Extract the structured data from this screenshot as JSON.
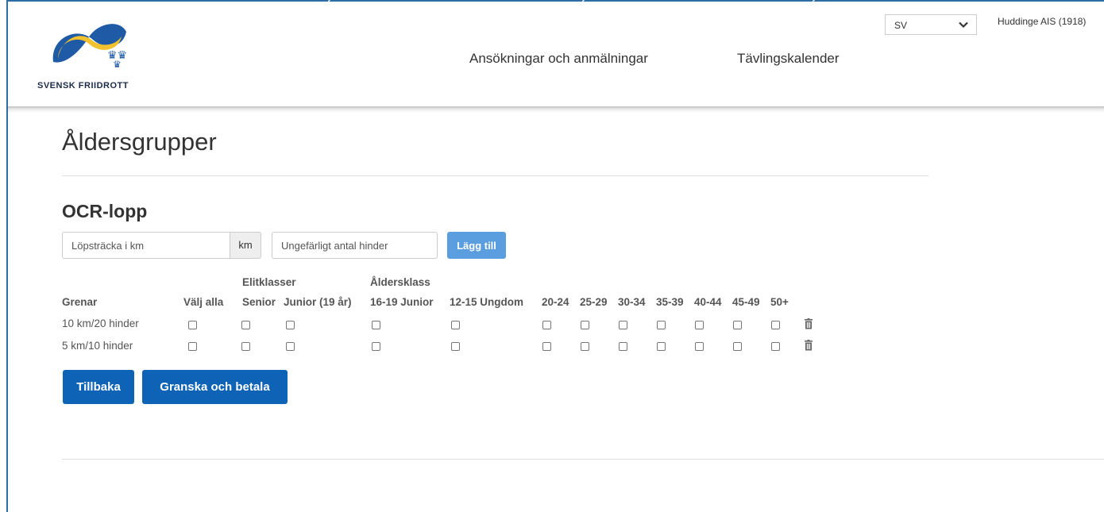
{
  "brand": {
    "logo_text": "SVENSK FRIIDROTT"
  },
  "nav": {
    "items": [
      "Ansökningar och anmälningar",
      "Tävlingskalender"
    ]
  },
  "language": {
    "selected": "SV"
  },
  "user": {
    "club": "Huddinge AIS (1918)"
  },
  "page": {
    "title": "Åldersgrupper"
  },
  "section": {
    "title": "OCR-lopp"
  },
  "form": {
    "distance_placeholder": "Löpsträcka i km",
    "unit": "km",
    "obstacles_placeholder": "Ungefärligt antal hinder",
    "add_button": "Lägg till"
  },
  "table": {
    "group_headers": {
      "elite": "Elitklasser",
      "age": "Åldersklass"
    },
    "columns": {
      "event": "Grenar",
      "select_all": "Välj alla",
      "senior": "Senior",
      "junior": "Junior (19 år)",
      "u19": "16-19 Junior",
      "u15": "12-15 Ungdom",
      "a20": "20-24",
      "a25": "25-29",
      "a30": "30-34",
      "a35": "35-39",
      "a40": "40-44",
      "a45": "45-49",
      "a50": "50+"
    },
    "rows": [
      {
        "label": "10 km/20 hinder"
      },
      {
        "label": "5 km/10 hinder"
      }
    ]
  },
  "actions": {
    "back": "Tillbaka",
    "review": "Granska och betala"
  },
  "colors": {
    "primary": "#0f63b7",
    "add_button": "#5a9ee0",
    "frame": "#2d6da4",
    "logo_blue": "#1f5aa6",
    "logo_yellow": "#f2c12e"
  },
  "icons": {
    "language_chevron": "chevron-down-icon",
    "delete": "trash-icon"
  }
}
